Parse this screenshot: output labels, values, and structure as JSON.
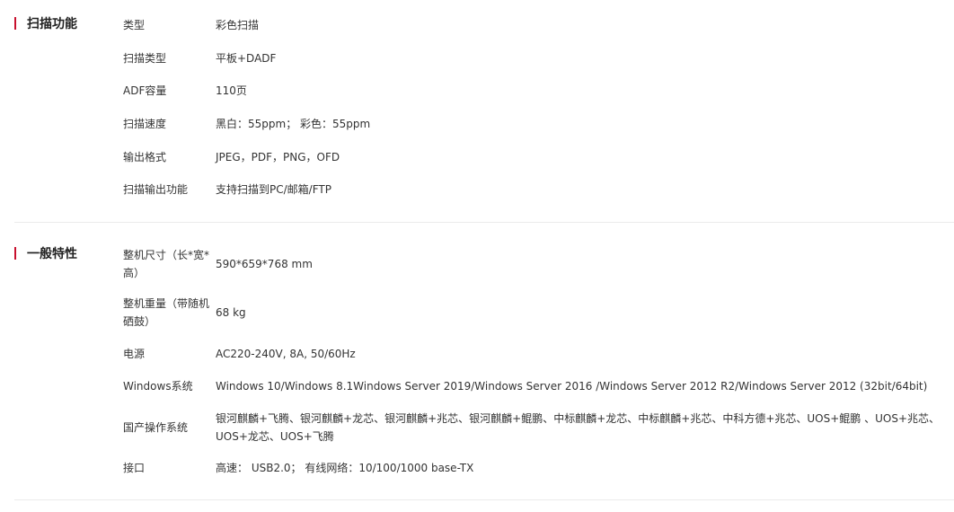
{
  "sections": [
    {
      "title": "扫描功能",
      "rows": [
        {
          "label": "类型",
          "value": "彩色扫描"
        },
        {
          "label": "扫描类型",
          "value": "平板+DADF"
        },
        {
          "label": "ADF容量",
          "value": "110页"
        },
        {
          "label": "扫描速度",
          "value": "黑白：55ppm； 彩色：55ppm"
        },
        {
          "label": "输出格式",
          "value": "JPEG，PDF，PNG，OFD"
        },
        {
          "label": "扫描输出功能",
          "value": "支持扫描到PC/邮箱/FTP"
        }
      ]
    },
    {
      "title": "一般特性",
      "rows": [
        {
          "label": "整机尺寸（长*宽*高）",
          "value": "590*659*768 mm"
        },
        {
          "label": "整机重量（带随机硒鼓）",
          "value": "68 kg"
        },
        {
          "label": "电源",
          "value": "AC220-240V, 8A, 50/60Hz"
        },
        {
          "label": "Windows系统",
          "value": "Windows 10/Windows 8.1Windows Server 2019/Windows Server 2016 /Windows Server 2012 R2/Windows Server 2012 (32bit/64bit)"
        },
        {
          "label": "国产操作系统",
          "value": "银河麒麟+飞腾、银河麒麟+龙芯、银河麒麟+兆芯、银河麒麟+鲲鹏、中标麒麟+龙芯、中标麒麟+兆芯、中科方德+兆芯、UOS+鲲鹏 、UOS+兆芯、UOS+龙芯、UOS+飞腾"
        },
        {
          "label": "接口",
          "value": "高速： USB2.0； 有线网络：10/100/1000 base-TX"
        }
      ]
    }
  ]
}
